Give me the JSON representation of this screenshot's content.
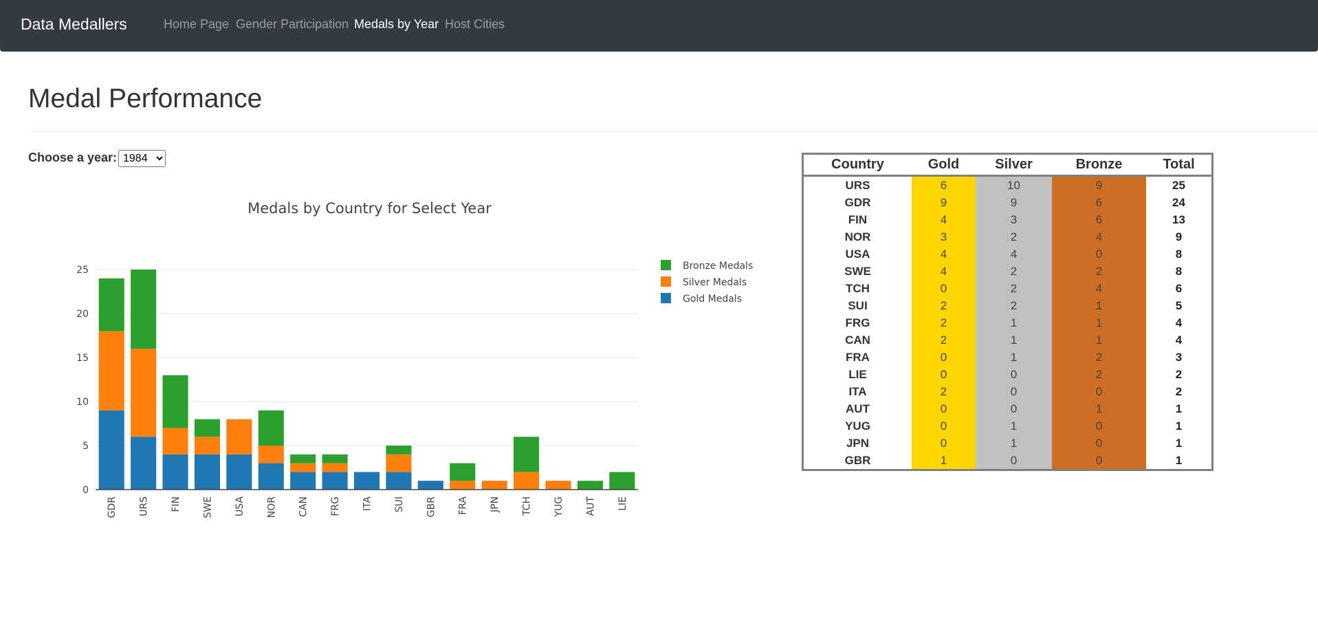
{
  "navbar": {
    "brand": "Data Medallers",
    "items": [
      {
        "label": "Home Page",
        "active": false
      },
      {
        "label": "Gender Participation",
        "active": false
      },
      {
        "label": "Medals by Year",
        "active": true
      },
      {
        "label": "Host Cities",
        "active": false
      }
    ]
  },
  "page": {
    "title": "Medal Performance",
    "year_label": "Choose a year:",
    "year_selected": "1984"
  },
  "chart_data": {
    "type": "bar",
    "stacked": true,
    "title": "Medals by Country for Select Year",
    "categories": [
      "GDR",
      "URS",
      "FIN",
      "SWE",
      "USA",
      "NOR",
      "CAN",
      "FRG",
      "ITA",
      "SUI",
      "GBR",
      "FRA",
      "JPN",
      "TCH",
      "YUG",
      "AUT",
      "LIE"
    ],
    "series": [
      {
        "name": "Gold Medals",
        "color": "#1f77b4",
        "values": [
          9,
          6,
          4,
          4,
          4,
          3,
          2,
          2,
          2,
          2,
          1,
          0,
          0,
          0,
          0,
          0,
          0
        ]
      },
      {
        "name": "Silver Medals",
        "color": "#ff7f0e",
        "values": [
          9,
          10,
          3,
          2,
          4,
          2,
          1,
          1,
          0,
          2,
          0,
          1,
          1,
          2,
          1,
          0,
          0
        ]
      },
      {
        "name": "Bronze Medals",
        "color": "#2ca02c",
        "values": [
          6,
          9,
          6,
          2,
          0,
          4,
          1,
          1,
          0,
          1,
          0,
          2,
          0,
          4,
          0,
          1,
          2
        ]
      }
    ],
    "legend_order": [
      "Bronze Medals",
      "Silver Medals",
      "Gold Medals"
    ],
    "legend_position": "right",
    "yticks": [
      0,
      5,
      10,
      15,
      20,
      25
    ],
    "ylim": [
      0,
      25
    ],
    "grid": true
  },
  "table": {
    "headers": [
      "Country",
      "Gold",
      "Silver",
      "Bronze",
      "Total"
    ],
    "rows": [
      [
        "URS",
        "6",
        "10",
        "9",
        "25"
      ],
      [
        "GDR",
        "9",
        "9",
        "6",
        "24"
      ],
      [
        "FIN",
        "4",
        "3",
        "6",
        "13"
      ],
      [
        "NOR",
        "3",
        "2",
        "4",
        "9"
      ],
      [
        "USA",
        "4",
        "4",
        "0",
        "8"
      ],
      [
        "SWE",
        "4",
        "2",
        "2",
        "8"
      ],
      [
        "TCH",
        "0",
        "2",
        "4",
        "6"
      ],
      [
        "SUI",
        "2",
        "2",
        "1",
        "5"
      ],
      [
        "FRG",
        "2",
        "1",
        "1",
        "4"
      ],
      [
        "CAN",
        "2",
        "1",
        "1",
        "4"
      ],
      [
        "FRA",
        "0",
        "1",
        "2",
        "3"
      ],
      [
        "LIE",
        "0",
        "0",
        "2",
        "2"
      ],
      [
        "ITA",
        "2",
        "0",
        "0",
        "2"
      ],
      [
        "AUT",
        "0",
        "0",
        "1",
        "1"
      ],
      [
        "YUG",
        "0",
        "1",
        "0",
        "1"
      ],
      [
        "JPN",
        "0",
        "1",
        "0",
        "1"
      ],
      [
        "GBR",
        "1",
        "0",
        "0",
        "1"
      ]
    ]
  }
}
